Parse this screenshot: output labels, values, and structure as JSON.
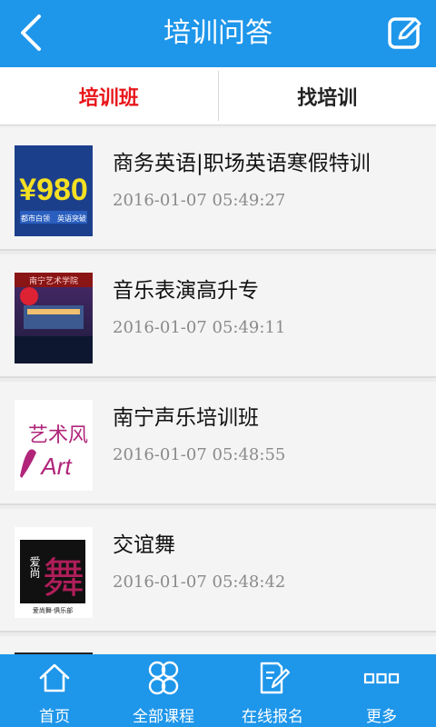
{
  "header": {
    "title": "培训问答",
    "back_icon": "back-arrow-icon",
    "edit_icon": "edit-icon"
  },
  "tabs": [
    {
      "label": "培训班",
      "active": true
    },
    {
      "label": "找培训",
      "active": false
    }
  ],
  "items": [
    {
      "title": "商务英语|职场英语寒假特训",
      "time": "2016-01-07 05:49:27",
      "thumb": {
        "price": "¥980",
        "caption": "都市白领　英语突破"
      }
    },
    {
      "title": "音乐表演高升专",
      "time": "2016-01-07 05:49:11",
      "thumb": {
        "sign": "南宁艺术学院"
      }
    },
    {
      "title": "南宁声乐培训班",
      "time": "2016-01-07 05:48:55",
      "thumb": {
        "line1": "艺术风",
        "line2": "Art"
      }
    },
    {
      "title": "交谊舞",
      "time": "2016-01-07 05:48:42",
      "thumb": {
        "chars": "爱尚",
        "big": "舞",
        "caption": "爱尚舞·俱乐部"
      }
    }
  ],
  "bottom_nav": [
    {
      "label": "首页",
      "icon": "home-icon"
    },
    {
      "label": "全部课程",
      "icon": "all-courses-icon"
    },
    {
      "label": "在线报名",
      "icon": "online-signup-icon"
    },
    {
      "label": "更多",
      "icon": "more-icon"
    }
  ],
  "colors": {
    "primary": "#1e96ea",
    "active_tab": "#e8161b",
    "time_text": "#8a8a8a"
  }
}
